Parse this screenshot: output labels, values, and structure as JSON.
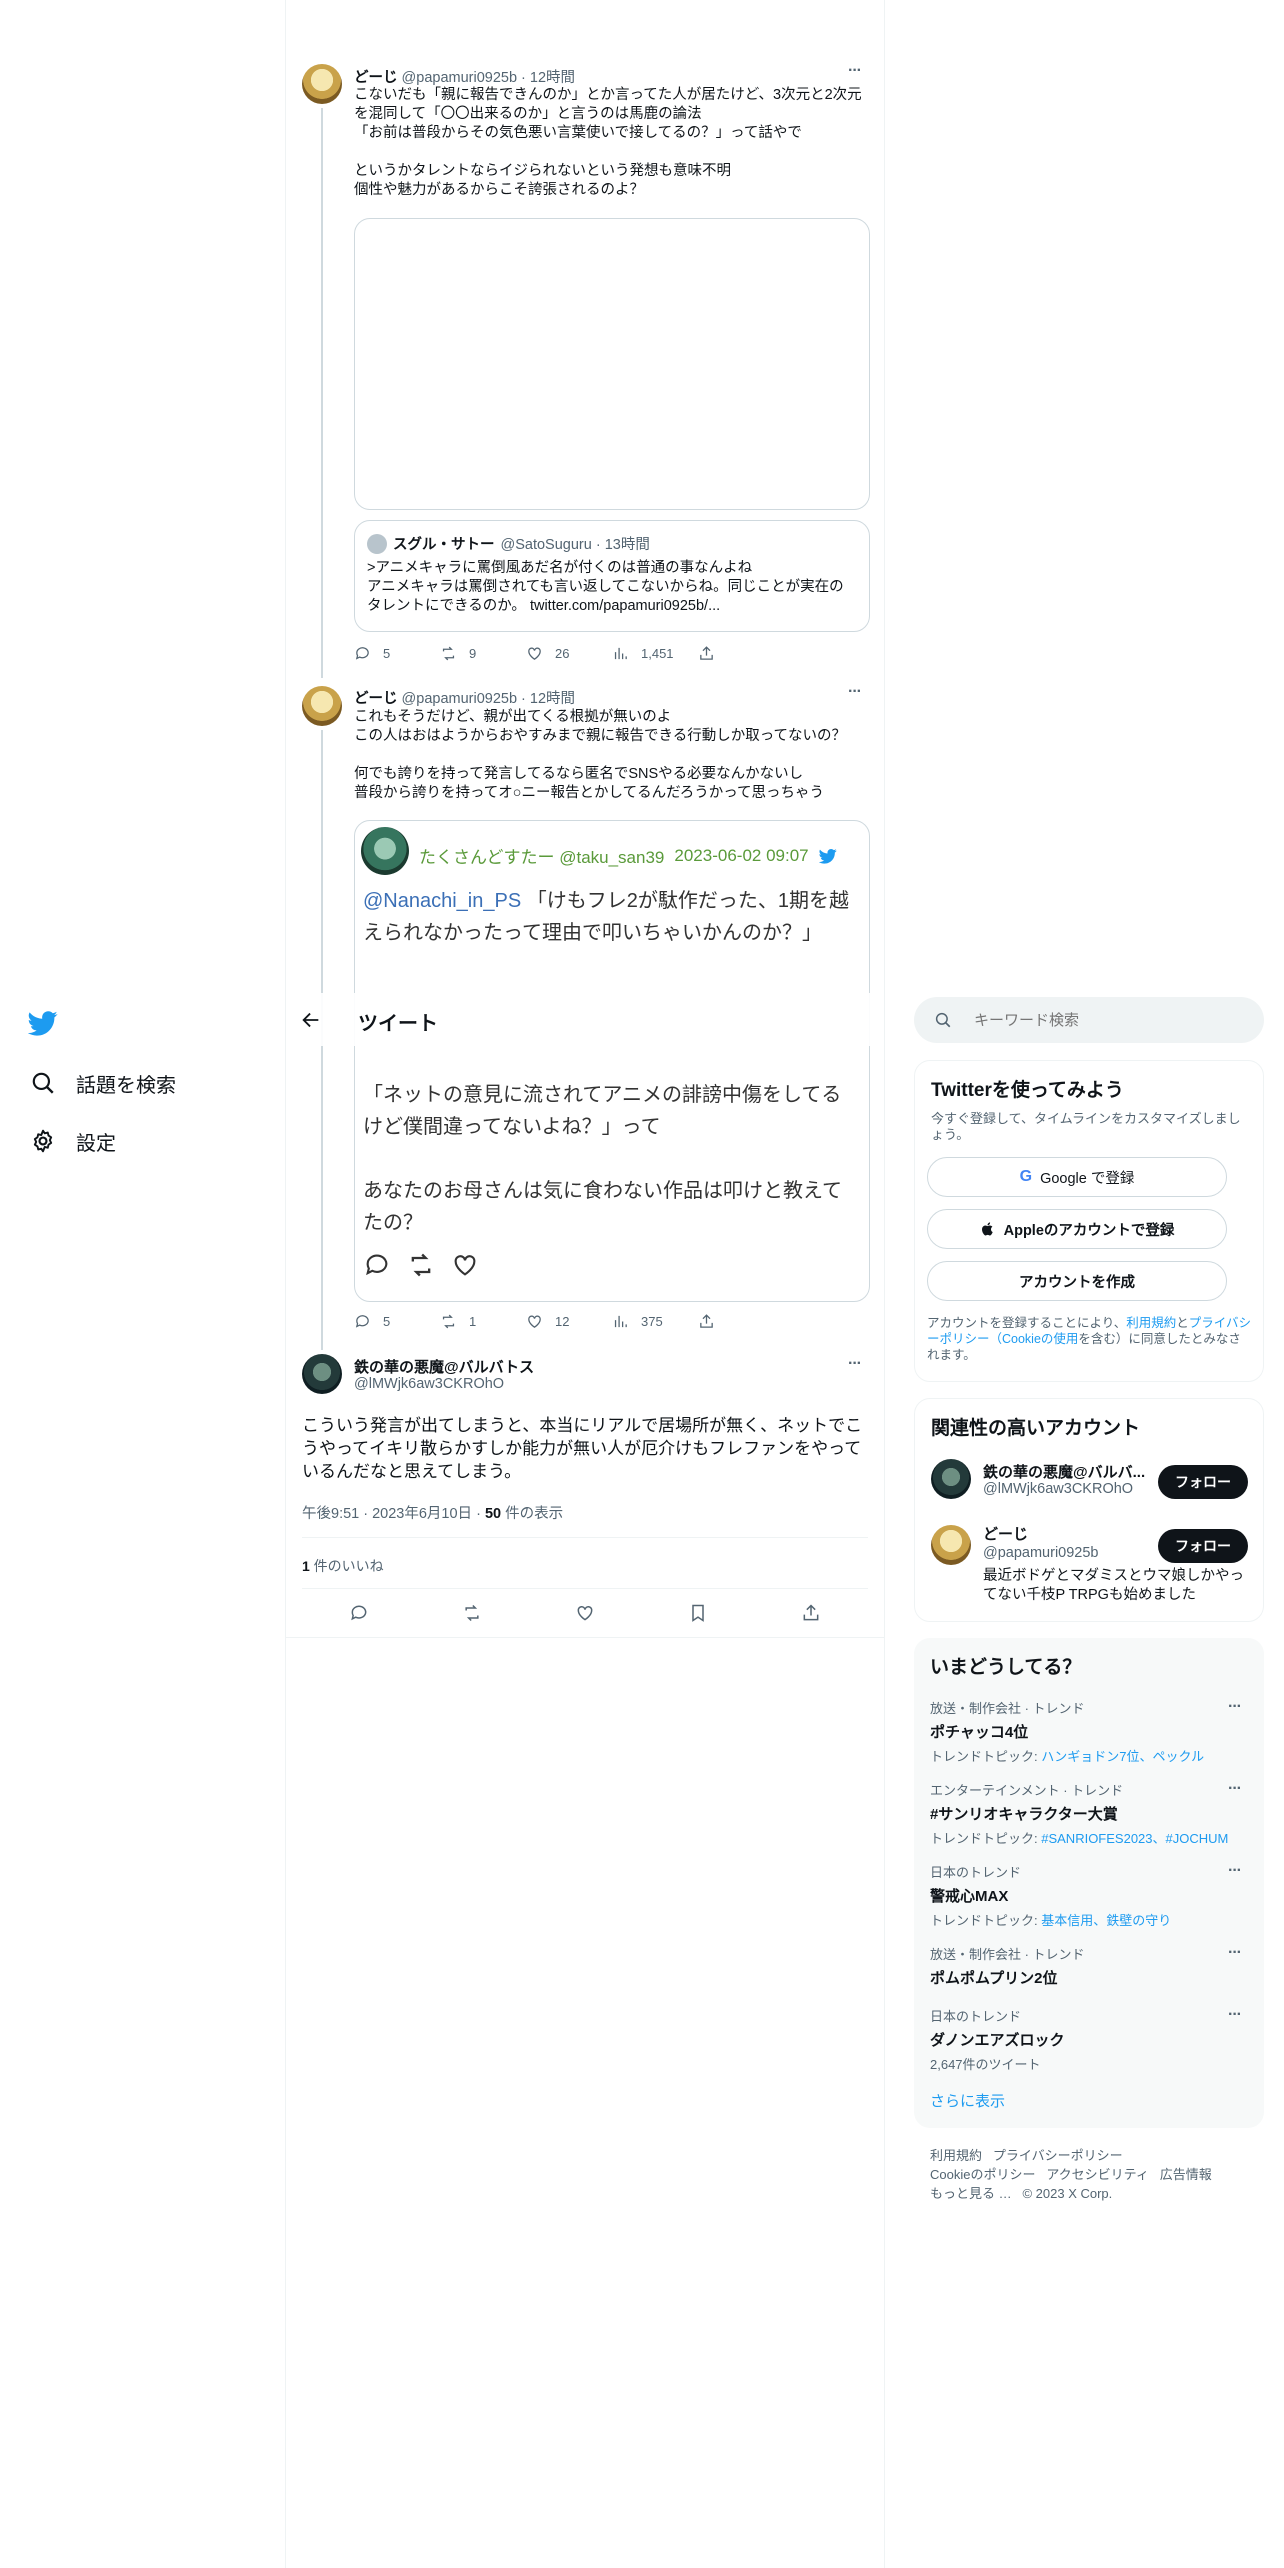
{
  "nav": {
    "search_label": "話題を検索",
    "settings_label": "設定"
  },
  "header": {
    "title": "ツイート"
  },
  "tweet1": {
    "name": "どーじ",
    "meta": "@papamuri0925b · 12時間",
    "text": "こないだも「親に報告できんのか」とか言ってた人が居たけど、3次元と2次元を混同して「〇〇出来るのか」と言うのは馬鹿の論法\n「お前は普段からその気色悪い言葉使いで接してるの？」って話やで\n\nというかタレントならイジられないという発想も意味不明\n個性や魅力があるからこそ誇張されるのよ？",
    "quote_name": "スグル・サトー",
    "quote_meta": "@SatoSuguru · 13時間",
    "quote_text": ">アニメキャラに罵倒風あだ名が付くのは普通の事なんよね\nアニメキャラは罵倒されても言い返してこないからね。同じことが実在のタレントにできるのか。 twitter.com/papamuri0925b/...",
    "replies": "5",
    "retweets": "9",
    "likes": "26",
    "views": "1,451"
  },
  "tweet2": {
    "name": "どーじ",
    "meta": "@papamuri0925b · 12時間",
    "text": "これもそうだけど、親が出てくる根拠が無いのよ\nこの人はおはようからおやすみまで親に報告できる行動しか取ってないの？\n\n何でも誇りを持って発言してるなら匿名でSNSやる必要なんかないし\n普段から誇りを持ってオ○ニー報告とかしてるんだろうかって思っちゃう",
    "embed_name": "たくさんどすたー @taku_san39",
    "embed_date": "2023-06-02 09:07",
    "embed_mention": "@Nanachi_in_PS",
    "embed_text_1": " 「けもフレ2が駄作だった、1期を越えられなかったって理由で叩いちゃいかんのか？」",
    "embed_text_2": "「ネットの意見に流されてアニメの誹謗中傷をしてるけど僕間違ってないよね？」って\n\nあなたのお母さんは気に食わない作品は叩けと教えてたの？",
    "replies": "5",
    "retweets": "1",
    "likes": "12",
    "views": "375"
  },
  "main_tweet": {
    "name": "鉄の華の悪魔@バルバトス",
    "handle": "@lMWjk6aw3CKROhO",
    "text": "こういう発言が出てしまうと、本当にリアルで居場所が無く、ネットでこうやってイキリ散らかすしか能力が無い人が厄介けもフレファンをやっているんだなと思えてしまう。",
    "time": "午後9:51 · 2023年6月10日 · ",
    "views_count": "50",
    "views_label": " 件の表示",
    "likes_count": "1",
    "likes_label": " 件のいいね"
  },
  "search": {
    "placeholder": "キーワード検索"
  },
  "signup": {
    "title": "Twitterを使ってみよう",
    "subtitle": "今すぐ登録して、タイムラインをカスタマイズしましょう。",
    "google_label": "Google で登録",
    "apple_label": "Appleのアカウントで登録",
    "create_label": "アカウントを作成",
    "terms_1": "アカウントを登録することにより、",
    "terms_link_1": "利用規約",
    "terms_2": "と",
    "terms_link_2": "プライバシーポリシー（Cookieの使用",
    "terms_3": "を含む）に同意したとみなされます。"
  },
  "related": {
    "title": "関連性の高いアカウント",
    "accounts": [
      {
        "name": "鉄の華の悪魔@バルバ...",
        "handle": "@lMWjk6aw3CKROhO",
        "bio": "",
        "follow": "フォロー"
      },
      {
        "name": "どーじ",
        "handle": "@papamuri0925b",
        "bio": "最近ボドゲとマダミスとウマ娘しかやってない千枝P TRPGも始めました",
        "follow": "フォロー"
      }
    ]
  },
  "trends": {
    "title": "いまどうしてる？",
    "items": [
      {
        "category": "放送・制作会社 · トレンド",
        "name": "ポチャッコ4位",
        "sub_label": "トレンドトピック: ",
        "sub_link": "ハンギョドン7位、ペックル"
      },
      {
        "category": "エンターテインメント · トレンド",
        "name": "#サンリオキャラクター大賞",
        "sub_label": "トレンドトピック: ",
        "sub_link": "#SANRIOFES2023、#JOCHUM"
      },
      {
        "category": "日本のトレンド",
        "name": "警戒心MAX",
        "sub_label": "トレンドトピック: ",
        "sub_link": "基本信用、鉄壁の守り"
      },
      {
        "category": "放送・制作会社 · トレンド",
        "name": "ポムポムプリン2位",
        "sub_label": "",
        "sub_link": ""
      },
      {
        "category": "日本のトレンド",
        "name": "ダノンエアズロック",
        "sub_label": "2,647件のツイート",
        "sub_link": ""
      }
    ],
    "more": "さらに表示"
  },
  "footer": {
    "terms": "利用規約",
    "privacy": "プライバシーポリシー",
    "cookie": "Cookieのポリシー",
    "accessibility": "アクセシビリティ",
    "ads": "広告情報",
    "more": "もっと見る …",
    "copyright": "© 2023 X Corp."
  },
  "colors": {
    "accent": "#1d9bf0",
    "text": "#0f1419",
    "muted": "#536471",
    "border": "#eff3f4",
    "embed_green": "#5a9a3a"
  }
}
